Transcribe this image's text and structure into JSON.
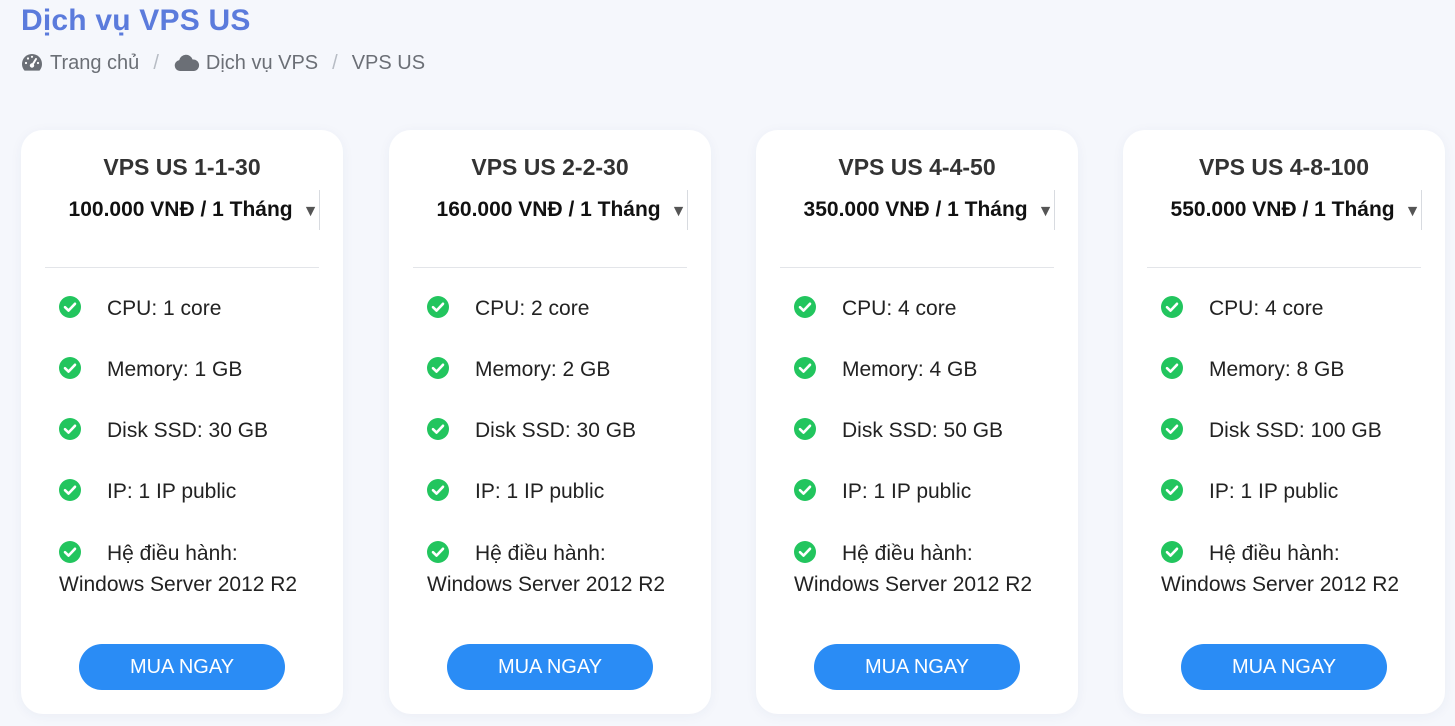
{
  "page": {
    "title": "Dịch vụ VPS US"
  },
  "breadcrumb": {
    "home": {
      "icon": "dashboard-icon",
      "label": "Trang chủ"
    },
    "section": {
      "icon": "cloud-icon",
      "label": "Dịch vụ VPS"
    },
    "current": {
      "label": "VPS US"
    },
    "separator": "/"
  },
  "colors": {
    "accent": "#5b7bdc",
    "button": "#2a8cf5",
    "check": "#22c55e"
  },
  "plans": [
    {
      "name": "VPS US 1-1-30",
      "price": "100.000 VNĐ / 1 Tháng",
      "features": [
        "CPU: 1 core",
        "Memory: 1 GB",
        "Disk SSD: 30 GB",
        "IP: 1 IP public"
      ],
      "os_label": "Hệ điều hành:",
      "os_value": "Windows Server 2012 R2",
      "button": "MUA NGAY"
    },
    {
      "name": "VPS US 2-2-30",
      "price": "160.000 VNĐ / 1 Tháng",
      "features": [
        "CPU: 2 core",
        "Memory: 2 GB",
        "Disk SSD: 30 GB",
        "IP: 1 IP public"
      ],
      "os_label": "Hệ điều hành:",
      "os_value": "Windows Server 2012 R2",
      "button": "MUA NGAY"
    },
    {
      "name": "VPS US 4-4-50",
      "price": "350.000 VNĐ / 1 Tháng",
      "features": [
        "CPU: 4 core",
        "Memory: 4 GB",
        "Disk SSD: 50 GB",
        "IP: 1 IP public"
      ],
      "os_label": "Hệ điều hành:",
      "os_value": "Windows Server 2012 R2",
      "button": "MUA NGAY"
    },
    {
      "name": "VPS US 4-8-100",
      "price": "550.000 VNĐ / 1 Tháng",
      "features": [
        "CPU: 4 core",
        "Memory: 8 GB",
        "Disk SSD: 100 GB",
        "IP: 1 IP public"
      ],
      "os_label": "Hệ điều hành:",
      "os_value": "Windows Server 2012 R2",
      "button": "MUA NGAY"
    }
  ]
}
